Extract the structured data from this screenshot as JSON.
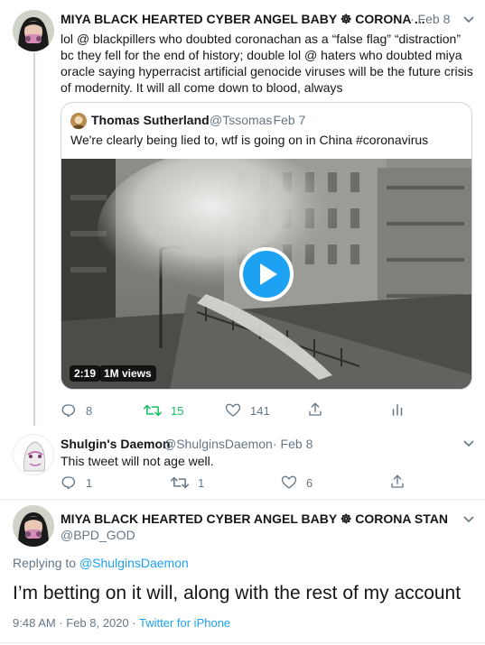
{
  "tweet1": {
    "name": "MIYA BLACK HEARTED CYBER ANGEL BABY ☸ CORONA ...",
    "time": "· Feb 8",
    "text": "lol @ blackpillers who doubted coronachan as a “false flag” “distraction” bc they fell for the end of history; double lol @ haters who doubted miya oracle saying hyperracist artificial genocide viruses will be the future crisis of modernity. It will all come down to blood, always",
    "quote": {
      "name": "Thomas Sutherland",
      "handle": "@Tssomas",
      "time": "· Feb 7",
      "text": "We're clearly being lied to, wtf is going on in China #coronavirus",
      "video_duration": "2:19",
      "video_views": "1M views"
    },
    "replies": "8",
    "retweets": "15",
    "likes": "141"
  },
  "tweet2": {
    "name": "Shulgin's Daemon",
    "handle": "@ShulginsDaemon",
    "time": "· Feb 8",
    "text": "This tweet will not age well.",
    "replies": "1",
    "retweets": "1",
    "likes": "6"
  },
  "tweet3": {
    "name": "MIYA BLACK HEARTED CYBER ANGEL BABY ☸ CORONA STAN",
    "handle": "@BPD_GOD",
    "replying_prefix": "Replying to",
    "replying_to": "@ShulginsDaemon",
    "text": "I’m betting on it will, along with the rest of my account",
    "timestamp": "9:48 AM · Feb 8, 2020",
    "sep": "·",
    "source": "Twitter for iPhone"
  },
  "colors": {
    "accent": "#1da1f2",
    "retweet_active": "#17bf63",
    "muted": "#657786"
  }
}
